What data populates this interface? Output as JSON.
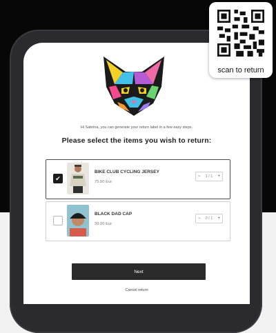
{
  "greeting": "Hi Sabrina, you can generate your return label in a few easy steps.",
  "heading": "Please select the items you wish to return:",
  "items": [
    {
      "name": "BIKE CLUB CYCLING JERSEY",
      "price": "75.00 Eur",
      "quantity": "1 / 1",
      "selected": true
    },
    {
      "name": "BLACK DAD CAP",
      "price": "39.00 Eur",
      "quantity": "0 / 1",
      "selected": false
    }
  ],
  "actions": {
    "next_label": "Next",
    "cancel_label": "Cancel return"
  },
  "qr": {
    "caption": "scan to return"
  },
  "stepper": {
    "minus": "−",
    "plus": "+"
  },
  "colors": {
    "dark_band": "#070707",
    "phone_frame": "#2b2b2d",
    "button": "#2a2a2a"
  },
  "icons": {
    "logo": "colorful-cat-logo-icon",
    "qr": "qr-code-icon",
    "check": "checkmark-icon"
  }
}
